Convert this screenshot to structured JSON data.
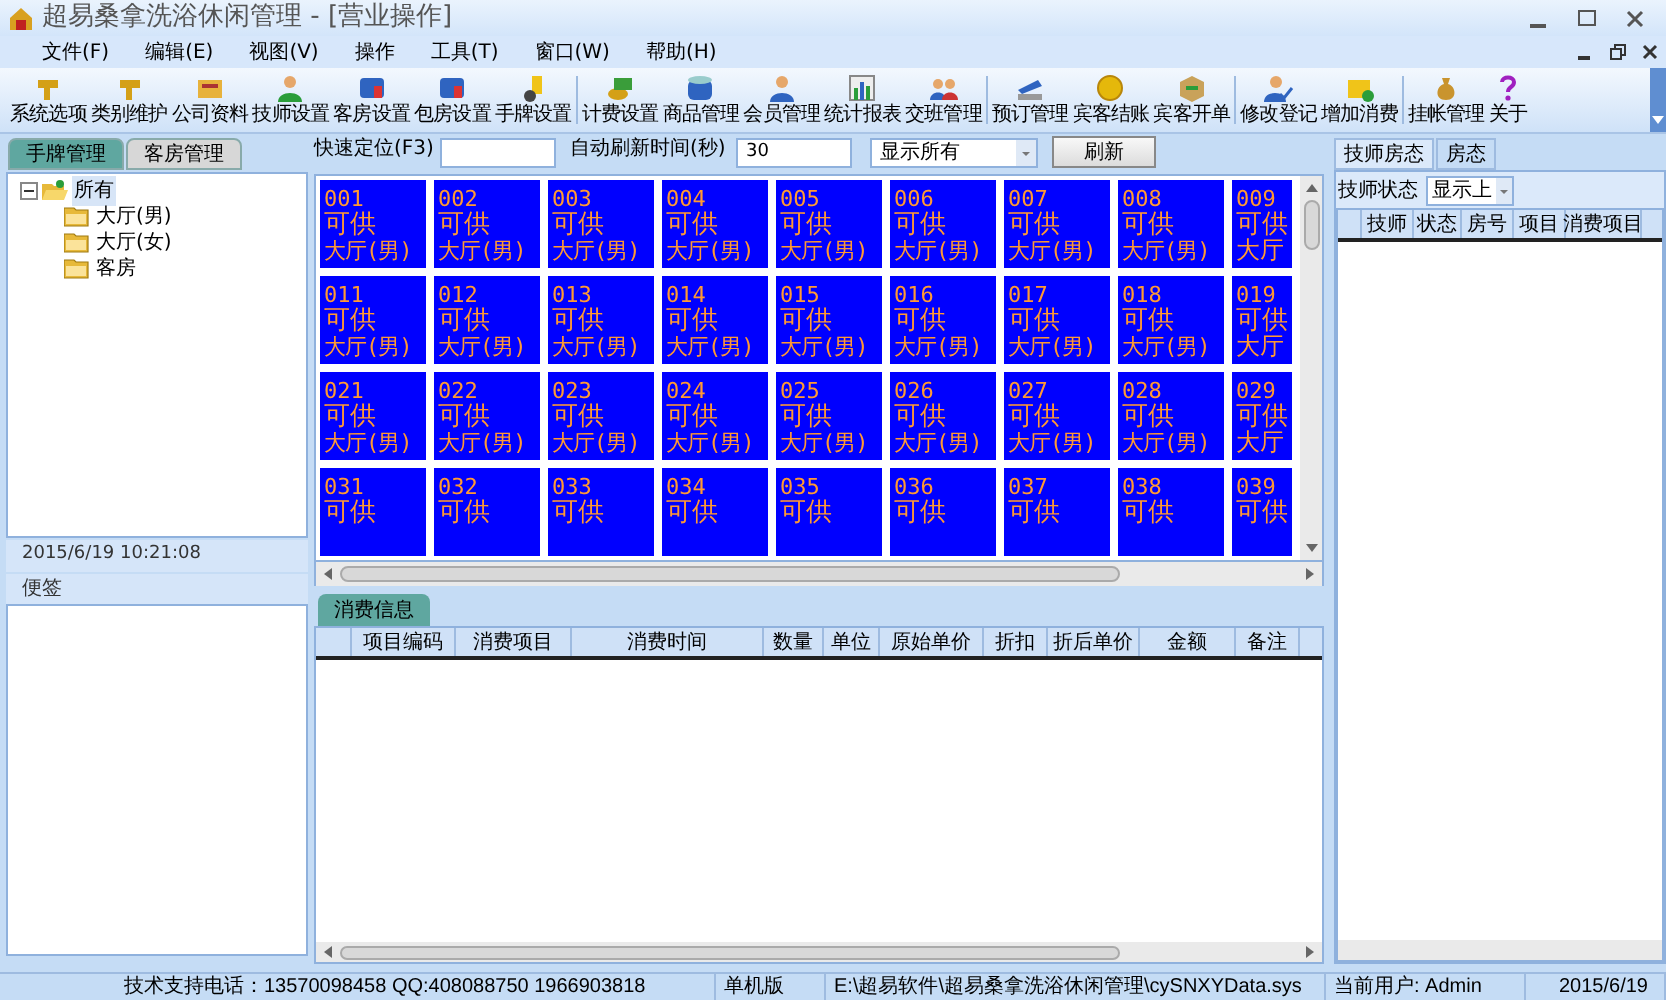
{
  "window": {
    "title": "超易桑拿洗浴休闲管理 - [营业操作]"
  },
  "menu": [
    "文件(F)",
    "编辑(E)",
    "视图(V)",
    "操作",
    "工具(T)",
    "窗口(W)",
    "帮助(H)"
  ],
  "toolbar": {
    "groups": [
      [
        "系统选项",
        "类别维护",
        "公司资料",
        "技师设置",
        "客房设置",
        "包房设置",
        "手牌设置"
      ],
      [
        "计费设置",
        "商品管理",
        "会员管理",
        "统计报表",
        "交班管理"
      ],
      [
        "预订管理",
        "宾客结账",
        "宾客开单"
      ],
      [
        "修改登记",
        "增加消费"
      ],
      [
        "挂帐管理",
        "关于"
      ]
    ]
  },
  "left_tabs": [
    {
      "label": "手牌管理",
      "selected": true
    },
    {
      "label": "客房管理",
      "selected": false
    }
  ],
  "tree": [
    {
      "label": "所有",
      "expanded": true,
      "selected": true,
      "children": [
        {
          "label": "大厅(男)"
        },
        {
          "label": "大厅(女)"
        },
        {
          "label": "客房"
        }
      ]
    }
  ],
  "datetime": "2015/6/19 10:21:08",
  "notes": {
    "title": "便签"
  },
  "quick": {
    "label": "快速定位(F3)"
  },
  "refresh": {
    "label": "自动刷新时间(秒)",
    "value": "30"
  },
  "filter": {
    "value": "显示所有"
  },
  "refresh_button": "刷新",
  "tiles": [
    [
      {
        "number": "001",
        "status": "可供",
        "area": "大厅(男)"
      },
      {
        "number": "002",
        "status": "可供",
        "area": "大厅(男)"
      },
      {
        "number": "003",
        "status": "可供",
        "area": "大厅(男)"
      },
      {
        "number": "004",
        "status": "可供",
        "area": "大厅(男)"
      },
      {
        "number": "005",
        "status": "可供",
        "area": "大厅(男)"
      },
      {
        "number": "006",
        "status": "可供",
        "area": "大厅(男)"
      },
      {
        "number": "007",
        "status": "可供",
        "area": "大厅(男)"
      },
      {
        "number": "008",
        "status": "可供",
        "area": "大厅(男)"
      },
      {
        "number": "009",
        "status": "可供",
        "area": "大厅"
      }
    ],
    [
      {
        "number": "011",
        "status": "可供",
        "area": "大厅(男)"
      },
      {
        "number": "012",
        "status": "可供",
        "area": "大厅(男)"
      },
      {
        "number": "013",
        "status": "可供",
        "area": "大厅(男)"
      },
      {
        "number": "014",
        "status": "可供",
        "area": "大厅(男)"
      },
      {
        "number": "015",
        "status": "可供",
        "area": "大厅(男)"
      },
      {
        "number": "016",
        "status": "可供",
        "area": "大厅(男)"
      },
      {
        "number": "017",
        "status": "可供",
        "area": "大厅(男)"
      },
      {
        "number": "018",
        "status": "可供",
        "area": "大厅(男)"
      },
      {
        "number": "019",
        "status": "可供",
        "area": "大厅"
      }
    ],
    [
      {
        "number": "021",
        "status": "可供",
        "area": "大厅(男)"
      },
      {
        "number": "022",
        "status": "可供",
        "area": "大厅(男)"
      },
      {
        "number": "023",
        "status": "可供",
        "area": "大厅(男)"
      },
      {
        "number": "024",
        "status": "可供",
        "area": "大厅(男)"
      },
      {
        "number": "025",
        "status": "可供",
        "area": "大厅(男)"
      },
      {
        "number": "026",
        "status": "可供",
        "area": "大厅(男)"
      },
      {
        "number": "027",
        "status": "可供",
        "area": "大厅(男)"
      },
      {
        "number": "028",
        "status": "可供",
        "area": "大厅(男)"
      },
      {
        "number": "029",
        "status": "可供",
        "area": "大厅"
      }
    ],
    [
      {
        "number": "031",
        "status": "可供"
      },
      {
        "number": "032",
        "status": "可供"
      },
      {
        "number": "033",
        "status": "可供"
      },
      {
        "number": "034",
        "status": "可供"
      },
      {
        "number": "035",
        "status": "可供"
      },
      {
        "number": "036",
        "status": "可供"
      },
      {
        "number": "037",
        "status": "可供"
      },
      {
        "number": "038",
        "status": "可供"
      },
      {
        "number": "039",
        "status": "可供"
      }
    ]
  ],
  "consumption": {
    "tab": "消费信息",
    "columns": [
      "项目编码",
      "消费项目",
      "消费时间",
      "数量",
      "单位",
      "原始单价",
      "折扣",
      "折后单价",
      "金额",
      "备注"
    ]
  },
  "right_tabs": [
    {
      "label": "技师房态",
      "selected": true
    },
    {
      "label": "房态",
      "selected": false
    }
  ],
  "tech_status": {
    "label": "技师状态",
    "value": "显示上"
  },
  "tech_table": {
    "columns": [
      "技师",
      "状态",
      "房号",
      "项目",
      "消费项目"
    ]
  },
  "status_bar": [
    "技术支持电话：13570098458 QQ:408088750 1966903818",
    "单机版",
    "E:\\超易软件\\超易桑拿洗浴休闲管理\\cySNXYData.sys",
    "当前用户: Admin",
    "2015/6/19"
  ]
}
